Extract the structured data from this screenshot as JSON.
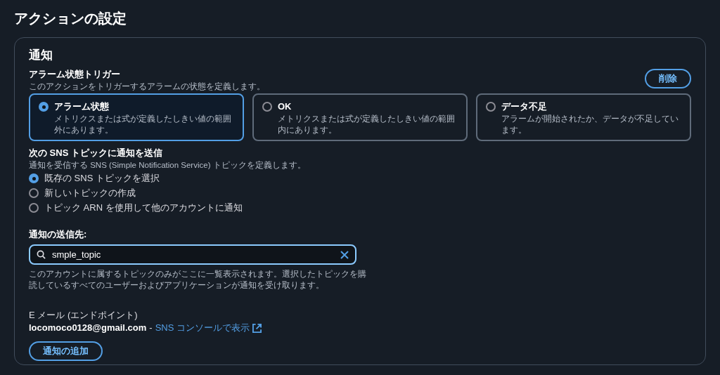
{
  "page_title": "アクションの設定",
  "panel": {
    "title": "通知",
    "trigger": {
      "label": "アラーム状態トリガー",
      "description": "このアクションをトリガーするアラームの状態を定義します。",
      "remove_button": "削除",
      "options": [
        {
          "label": "アラーム状態",
          "description": "メトリクスまたは式が定義したしきい値の範囲外にあります。",
          "selected": true
        },
        {
          "label": "OK",
          "description": "メトリクスまたは式が定義したしきい値の範囲内にあります。",
          "selected": false
        },
        {
          "label": "データ不足",
          "description": "アラームが開始されたか、データが不足しています。",
          "selected": false
        }
      ]
    },
    "sns": {
      "label": "次の SNS トピックに通知を送信",
      "description": "通知を受信する SNS (Simple Notification Service) トピックを定義します。",
      "options": [
        {
          "label": "既存の SNS トピックを選択",
          "selected": true
        },
        {
          "label": "新しいトピックの作成",
          "selected": false
        },
        {
          "label": "トピック ARN を使用して他のアカウントに通知",
          "selected": false
        }
      ]
    },
    "destination": {
      "label": "通知の送信先:",
      "value": "smple_topic",
      "help": "このアカウントに属するトピックのみがここに一覧表示されます。選択したトピックを購読しているすべてのユーザーおよびアプリケーションが通知を受け取ります。"
    },
    "endpoint": {
      "label": "E メール (エンドポイント)",
      "email": "locomoco0128@gmail.com",
      "separator": "-",
      "link": "SNS コンソールで表示"
    },
    "add_button": "通知の追加"
  }
}
